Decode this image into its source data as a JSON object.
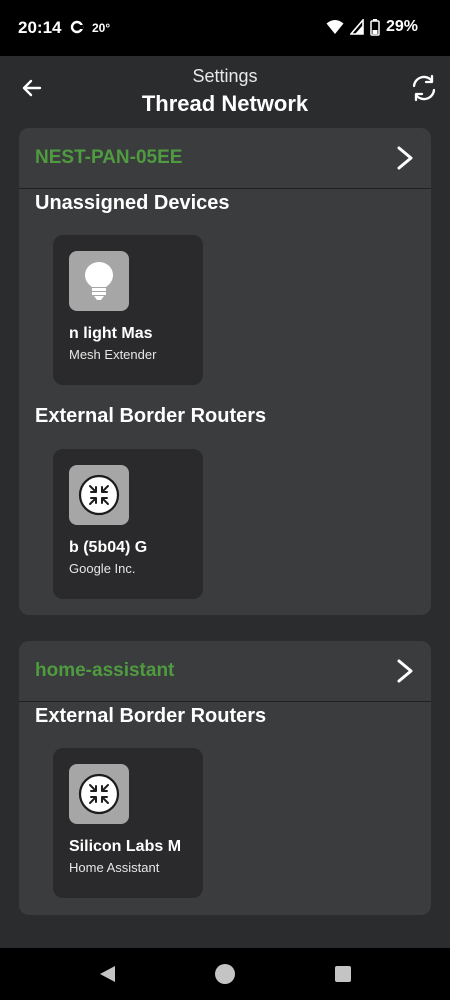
{
  "status_bar": {
    "time": "20:14",
    "temperature": "20°",
    "battery": "29%"
  },
  "header": {
    "subtitle": "Settings",
    "title": "Thread Network"
  },
  "networks": [
    {
      "name": "NEST-PAN-05EE",
      "sections": [
        {
          "title": "Unassigned Devices",
          "devices": [
            {
              "name": "n light     Mas",
              "subtitle": "Mesh Extender",
              "icon": "lightbulb-icon"
            }
          ]
        },
        {
          "title": "External Border Routers",
          "devices": [
            {
              "name": "b (5b04)       G",
              "subtitle": "Google Inc.",
              "icon": "border-router-icon"
            }
          ]
        }
      ]
    },
    {
      "name": "home-assistant",
      "sections": [
        {
          "title": "External Border Routers",
          "devices": [
            {
              "name": "Silicon Labs M",
              "subtitle": "Home Assistant",
              "icon": "border-router-icon"
            }
          ]
        }
      ]
    }
  ],
  "colors": {
    "network_name": "#4e9b40",
    "background": "#2b2c2e",
    "card": "#3b3c3e",
    "tile": "#2a2a2c"
  }
}
